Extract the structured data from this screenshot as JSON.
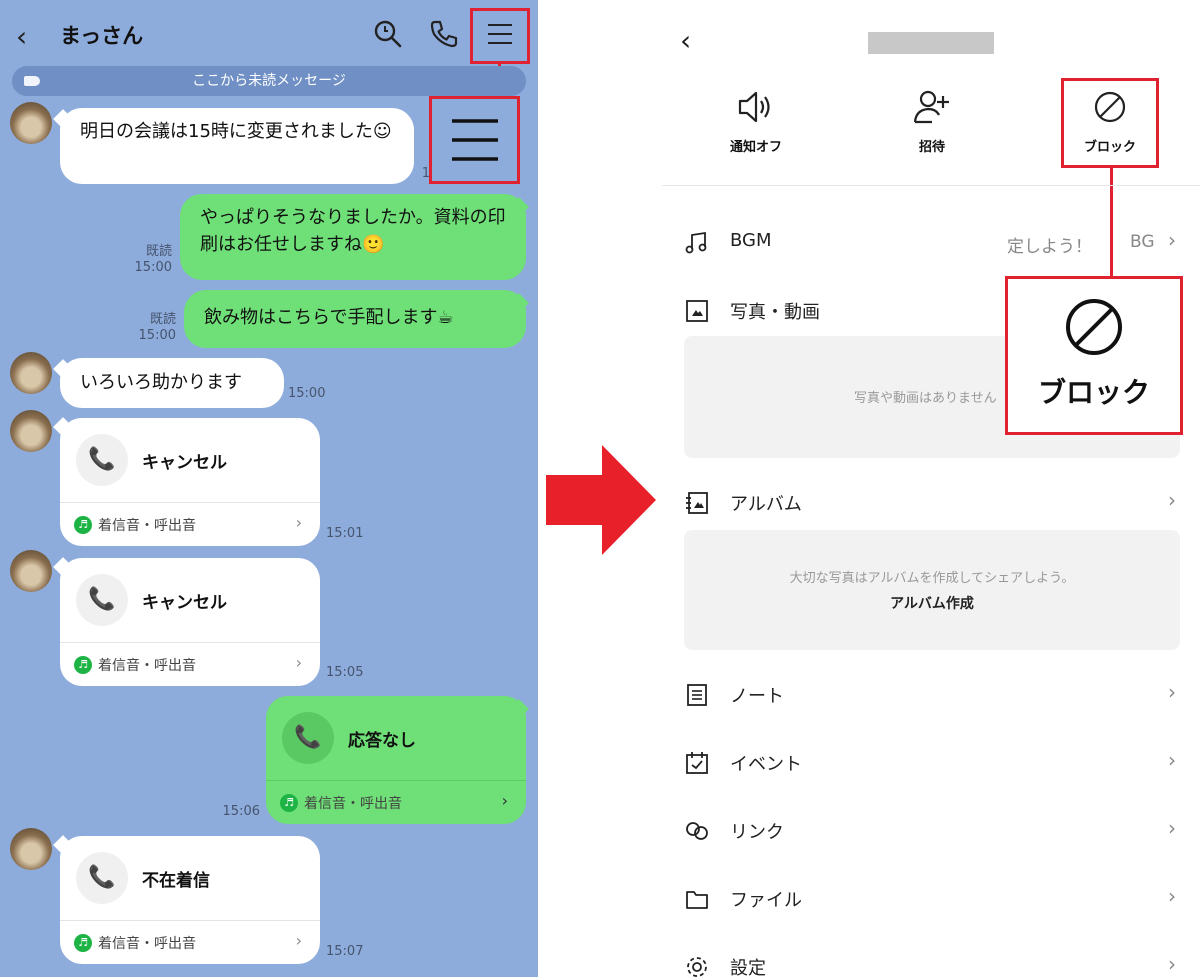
{
  "chat": {
    "title": "まっさん",
    "unread_banner": "ここから未読メッセージ",
    "messages": [
      {
        "text": "明日の会議は15時に変更されました☺",
        "time": "1"
      },
      {
        "text": "やっぱりそうなりましたか。資料の印刷はお任せしますね🙂",
        "read": "既読",
        "time": "15:00"
      },
      {
        "text": "飲み物はこちらで手配します☕",
        "read": "既読",
        "time": "15:00"
      },
      {
        "text": "いろいろ助かります",
        "time": "15:00"
      }
    ],
    "calls": [
      {
        "label": "キャンセル",
        "sub": "着信音・呼出音",
        "time": "15:01"
      },
      {
        "label": "キャンセル",
        "sub": "着信音・呼出音",
        "time": "15:05"
      },
      {
        "label": "応答なし",
        "sub": "着信音・呼出音",
        "time": "15:06"
      },
      {
        "label": "不在着信",
        "sub": "着信音・呼出音",
        "time": "15:07"
      }
    ]
  },
  "settings": {
    "actions": [
      {
        "label": "通知オフ",
        "icon": "speaker-icon"
      },
      {
        "label": "招待",
        "icon": "add-person-icon"
      },
      {
        "label": "ブロック",
        "icon": "block-icon"
      }
    ],
    "rows": {
      "bgm": {
        "label": "BGM",
        "value": "定しよう！",
        "value2": "BG"
      },
      "photos": {
        "label": "写真・動画",
        "empty": "写真や動画はありません"
      },
      "album": {
        "label": "アルバム",
        "empty": "大切な写真はアルバムを作成してシェアしよう。",
        "create": "アルバム作成"
      },
      "note": {
        "label": "ノート"
      },
      "event": {
        "label": "イベント"
      },
      "link": {
        "label": "リンク"
      },
      "file": {
        "label": "ファイル"
      },
      "settings": {
        "label": "設定"
      }
    },
    "zoom_label": "ブロック"
  },
  "colors": {
    "chat_bg": "#8eacdb",
    "bubble_green": "#6fe077",
    "highlight_red": "#e0212f",
    "arrow_red": "#e8202a"
  }
}
